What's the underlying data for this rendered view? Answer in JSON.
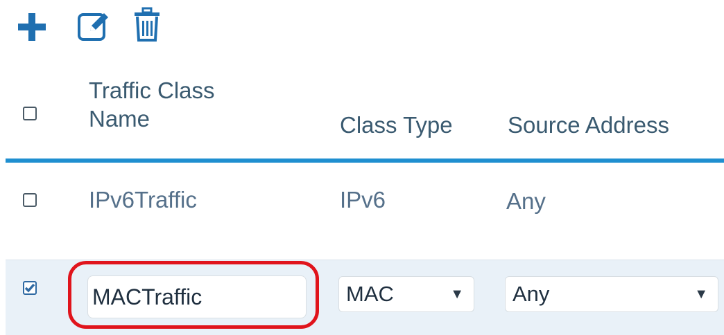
{
  "toolbar": {
    "add_icon": "plus-icon",
    "edit_icon": "edit-icon",
    "delete_icon": "trash-icon"
  },
  "table": {
    "columns": [
      {
        "label_line1": "Traffic Class",
        "label_line2": "Name"
      },
      {
        "label": "Class Type"
      },
      {
        "label": "Source Address"
      }
    ],
    "rows": [
      {
        "name": "IPv6Traffic",
        "class_type": "IPv6",
        "source": "Any",
        "checked": false
      },
      {
        "name": "MACTraffic",
        "class_type": "MAC",
        "source": "Any",
        "checked": true,
        "editing": true
      }
    ]
  },
  "colors": {
    "accent": "#1f8fd0",
    "highlight": "#e0141c",
    "selected_row": "#e9f1f8",
    "icon": "#1f6fb0"
  }
}
